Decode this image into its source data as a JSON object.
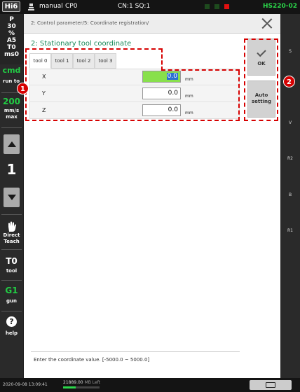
{
  "topbar": {
    "logo": "Hi6",
    "mode": "manual",
    "program": "CP0",
    "step": "CN:1 SQ:1",
    "model": "HS220-02"
  },
  "leftbar": {
    "info": [
      "P",
      "30",
      "%",
      "A5",
      "T0",
      "ms0"
    ],
    "cmd": "cmd",
    "run_to": "run to",
    "speed_value": "200",
    "speed_unit_1": "mm/s",
    "speed_unit_2": "max",
    "step_number": "1",
    "direct_teach_1": "Direct",
    "direct_teach_2": "Teach",
    "tool_value": "T0",
    "tool_label": "tool",
    "gun_value": "G1",
    "gun_label": "gun",
    "help_icon": "?",
    "help_label": "help"
  },
  "rightbar": {
    "labels": [
      "S",
      "V",
      "R2",
      "B",
      "R1"
    ]
  },
  "header": {
    "breadcrumb": "2: Control parameter/5: Coordinate registration/"
  },
  "main": {
    "title": "2: Stationary tool coordinate",
    "tabs": [
      "tool 0",
      "tool 1",
      "tool 2",
      "tool 3"
    ],
    "active_tab": 0,
    "rows": [
      {
        "label": "X",
        "value": "0.0",
        "unit": "mm"
      },
      {
        "label": "Y",
        "value": "0.0",
        "unit": "mm"
      },
      {
        "label": "Z",
        "value": "0.0",
        "unit": "mm"
      }
    ],
    "ok_label": "OK",
    "auto_label_1": "Auto",
    "auto_label_2": "setting",
    "message": "Enter the coordinate value. [-5000.0 ~ 5000.0]"
  },
  "annotations": {
    "badge1": "1",
    "badge2": "2",
    "accent": "#d60000"
  },
  "bottombar": {
    "datetime": "2020-09-08 13:09:41",
    "memory_value": "21889.00",
    "memory_label": "MB Left",
    "memory_fraction": 0.35
  }
}
